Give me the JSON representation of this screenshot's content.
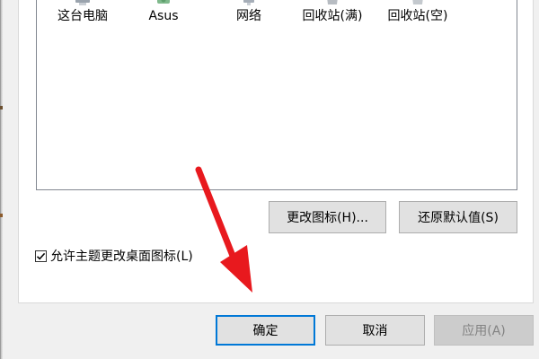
{
  "desktop_icons": [
    {
      "label": "这台电脑",
      "icon": "computer-icon"
    },
    {
      "label": "Asus",
      "icon": "user-folder-icon"
    },
    {
      "label": "网络",
      "icon": "network-icon"
    },
    {
      "label": "回收站(满)",
      "icon": "recycle-bin-full-icon"
    },
    {
      "label": "回收站(空)",
      "icon": "recycle-bin-empty-icon"
    }
  ],
  "icon_buttons": {
    "change_icon": "更改图标(H)...",
    "restore_default": "还原默认值(S)"
  },
  "allow_themes": {
    "label": "允许主题更改桌面图标(L)",
    "checked": true
  },
  "dialog_buttons": {
    "ok": "确定",
    "cancel": "取消",
    "apply": "应用(A)",
    "apply_enabled": false
  },
  "annotation": {
    "arrow_color": "#e8191e",
    "points_to": "确定"
  },
  "colors": {
    "default_button_border": "#0078d7",
    "panel_background": "#ffffff",
    "dialog_background": "#f0f0f0"
  }
}
